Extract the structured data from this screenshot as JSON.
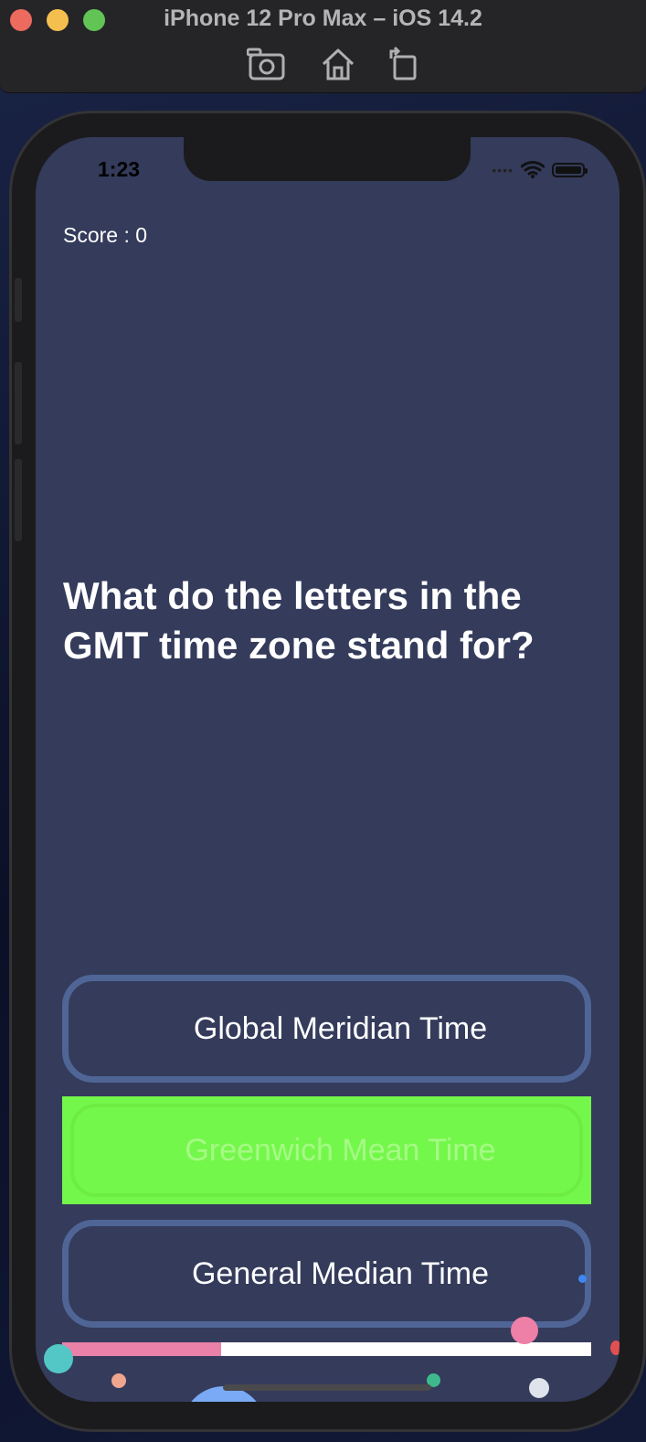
{
  "simulator": {
    "title": "iPhone 12 Pro Max – iOS 14.2",
    "toolbar_icons": [
      "screenshot-icon",
      "home-icon",
      "rotate-icon"
    ]
  },
  "status_bar": {
    "time": "1:23"
  },
  "game": {
    "score_text": "Score : 0",
    "question": "What do the letters in the GMT time zone stand for?",
    "answers": [
      {
        "label": "Global Meridian Time",
        "state": "default"
      },
      {
        "label": "Greenwich Mean Time",
        "state": "correct"
      },
      {
        "label": "General Median Time",
        "state": "default"
      }
    ],
    "progress_fraction": 0.3
  },
  "colors": {
    "screen_bg": "#343b5b",
    "answer_border": "#4f6596",
    "correct_bg": "#74f74b",
    "progress_fill": "#ea81a8"
  }
}
